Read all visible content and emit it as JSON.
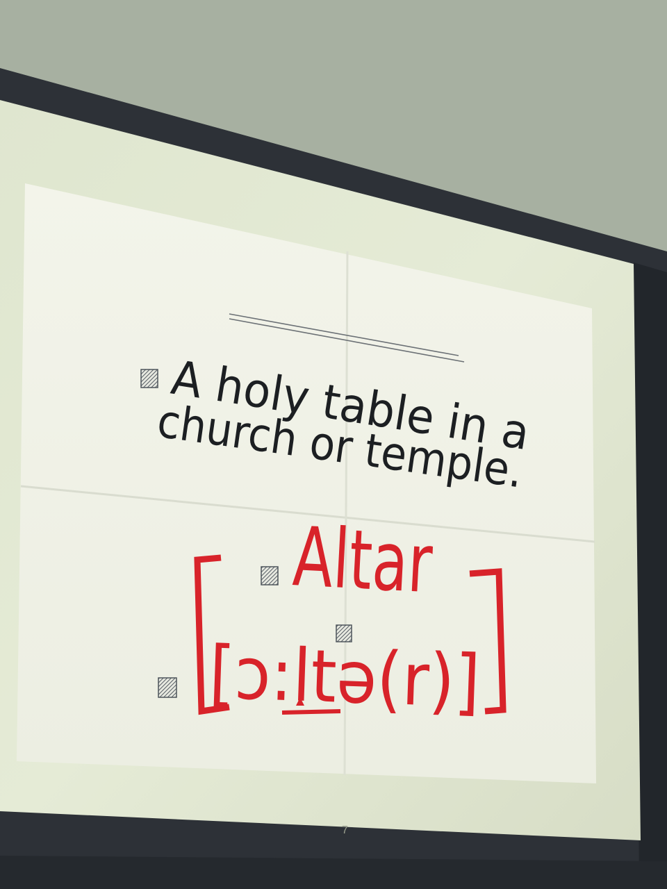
{
  "slide": {
    "definition_line_1": "A holy table in a",
    "definition_line_2": "church or temple.",
    "word": "Altar",
    "pronunciation": "[ɔ:ltə(r)]",
    "page_number": "7"
  },
  "colors": {
    "wall": "#a6af9f",
    "bezel": "#2c3036",
    "screen": "#e2e8d0",
    "paper": "#f0f2e6",
    "definition_ink": "#1c1f22",
    "word_ink": "#d8232a",
    "bullet": "#596068"
  },
  "icons": {
    "bullet": "hatched-square-bullet-icon"
  }
}
